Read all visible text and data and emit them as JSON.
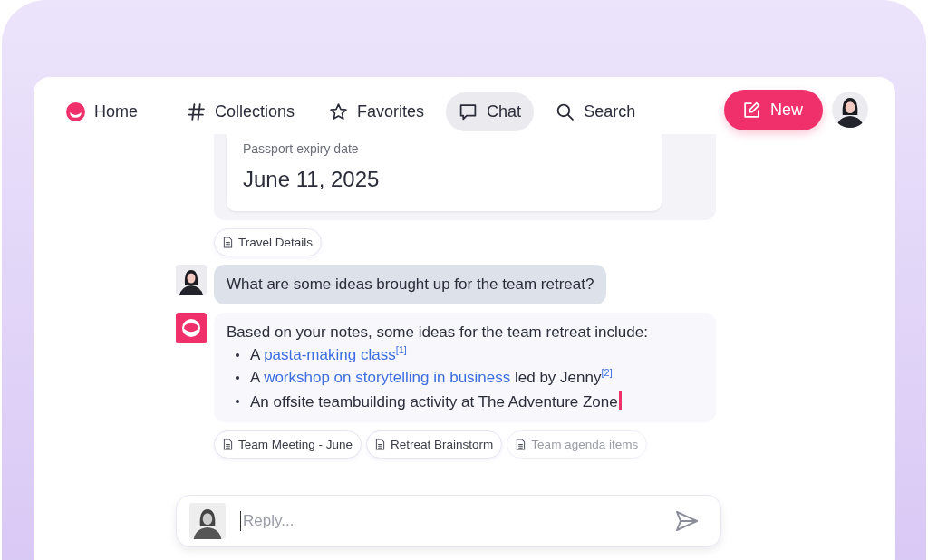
{
  "nav": {
    "items": [
      {
        "label": "Home",
        "selected": false
      },
      {
        "label": "Collections",
        "selected": false
      },
      {
        "label": "Favorites",
        "selected": false
      },
      {
        "label": "Chat",
        "selected": true
      },
      {
        "label": "Search",
        "selected": false
      }
    ],
    "new_button": "New"
  },
  "record_card": {
    "label": "Passport expiry date",
    "value": "June 11, 2025"
  },
  "record_sources": [
    {
      "label": "Travel Details",
      "faded": false
    }
  ],
  "messages": [
    {
      "kind": "user",
      "text": "What are some ideas brought up for the team retreat?"
    },
    {
      "kind": "assistant",
      "intro": "Based on your notes, some ideas for the team retreat include:",
      "typing_cursor": true,
      "bullets": [
        [
          {
            "kind": "text",
            "text": "A "
          },
          {
            "kind": "link",
            "text": "pasta-making class"
          },
          {
            "kind": "citation",
            "text": "[1]"
          }
        ],
        [
          {
            "kind": "text",
            "text": "A "
          },
          {
            "kind": "link",
            "text": "workshop on storytelling in business"
          },
          {
            "kind": "text",
            "text": " led by Jenny"
          },
          {
            "kind": "citation",
            "text": "[2]"
          }
        ],
        [
          {
            "kind": "text",
            "text": "An offsite teambuilding activity at The Adventure Zone"
          }
        ]
      ]
    }
  ],
  "sources": [
    {
      "label": "Team Meeting - June",
      "faded": false
    },
    {
      "label": "Retreat Brainstorm",
      "faded": false
    },
    {
      "label": "Team agenda items",
      "faded": true
    }
  ],
  "reply": {
    "placeholder": "Reply..."
  }
}
